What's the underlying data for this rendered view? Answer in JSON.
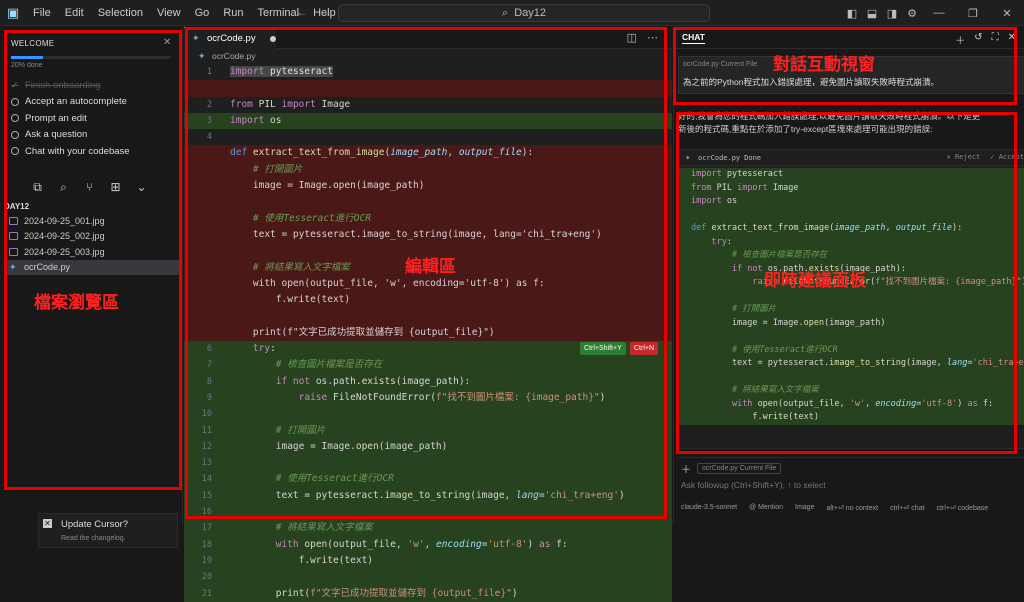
{
  "titlebar": {
    "app_icon": "cursor-app-icon",
    "menu": [
      "File",
      "Edit",
      "Selection",
      "View",
      "Go",
      "Run",
      "Terminal",
      "Help"
    ],
    "search_text": "Day12"
  },
  "sidebar": {
    "welcome_title": "WELCOME",
    "progress_text": "20% done",
    "progress_fraction": 0.2,
    "steps": [
      {
        "label": "Finish onboarding",
        "done": true
      },
      {
        "label": "Accept an autocomplete",
        "done": false
      },
      {
        "label": "Prompt an edit",
        "done": false
      },
      {
        "label": "Ask a question",
        "done": false
      },
      {
        "label": "Chat with your codebase",
        "done": false
      }
    ],
    "folder": "DAY12",
    "files": [
      {
        "name": "2024-09-25_001.jpg",
        "type": "image"
      },
      {
        "name": "2024-09-25_002.jpg",
        "type": "image"
      },
      {
        "name": "2024-09-25_003.jpg",
        "type": "image"
      },
      {
        "name": "ocrCode.py",
        "type": "python",
        "selected": true
      }
    ],
    "update_title": "Update Cursor?",
    "update_sub": "Read the changelog."
  },
  "editor": {
    "tab_label": "ocrCode.py",
    "breadcrumb": "ocrCode.py",
    "accept_label": "Ctrl+Shift+Y",
    "reject_label": "Ctrl+N"
  },
  "chat": {
    "header": "CHAT",
    "user_file_chip": "ocrCode.py Current File",
    "user_message": "為之前的Python程式加入錯誤處理，避免圖片讀取失敗時程式崩潰。",
    "reply_line1": "好的,我會為您的程式碼加入錯誤處理,以避免圖片讀取失敗時程式崩潰。以下是更",
    "reply_line2": "新後的程式碼,重點在於添加了try-except區塊來處理可能出現的錯誤:",
    "code_file": "ocrCode.py",
    "code_status": "Done",
    "reject": "Reject",
    "accept": "Accept",
    "input_chip": "ocrCode.py Current File",
    "input_placeholder": "Ask followup (Ctrl+Shift+Y), ↑ to select",
    "footer": [
      "claude-3.5-sonnet",
      "@ Mention",
      "Image",
      "alt+⏎ no context",
      "ctrl+⏎ chat",
      "ctrl+⏎ codebase"
    ]
  },
  "annotations": {
    "files": "檔案瀏覽區",
    "editor": "編輯區",
    "chat_window": "對話互動視窗",
    "suggestion": "即時建議面板"
  }
}
